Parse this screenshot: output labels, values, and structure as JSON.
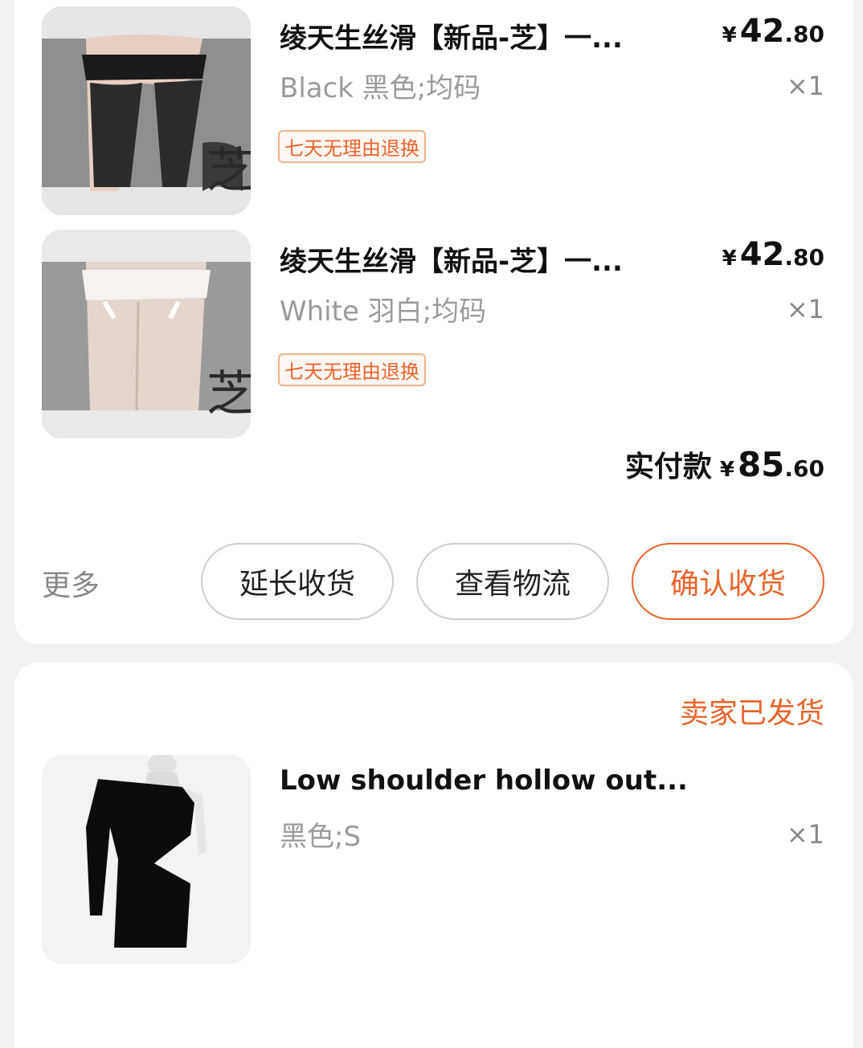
{
  "order1": {
    "items": [
      {
        "title": "绫天生丝滑【新品-芝】一...",
        "sku": "Black 黑色;均码",
        "price_currency": "¥",
        "price_int": "42",
        "price_dec": ".80",
        "qty": "×1",
        "tag": "七天无理由退换",
        "image_icon": "black-stockings-image"
      },
      {
        "title": "绫天生丝滑【新品-芝】一...",
        "sku": "White 羽白;均码",
        "price_currency": "¥",
        "price_int": "42",
        "price_dec": ".80",
        "qty": "×1",
        "tag": "七天无理由退换",
        "image_icon": "white-stockings-image"
      }
    ],
    "total": {
      "label": "实付款",
      "currency": "¥",
      "int": "85",
      "dec": ".60"
    },
    "actions": {
      "more": "更多",
      "extend": "延长收货",
      "logistics": "查看物流",
      "confirm": "确认收货"
    }
  },
  "order2": {
    "status": "卖家已发货",
    "item": {
      "title": "Low shoulder hollow out...",
      "sku": "黑色;S",
      "qty": "×1",
      "image_icon": "black-dress-image"
    }
  },
  "colors": {
    "accent": "#e8642b",
    "muted": "#9a9a9a",
    "background": "#f2f2f2"
  }
}
